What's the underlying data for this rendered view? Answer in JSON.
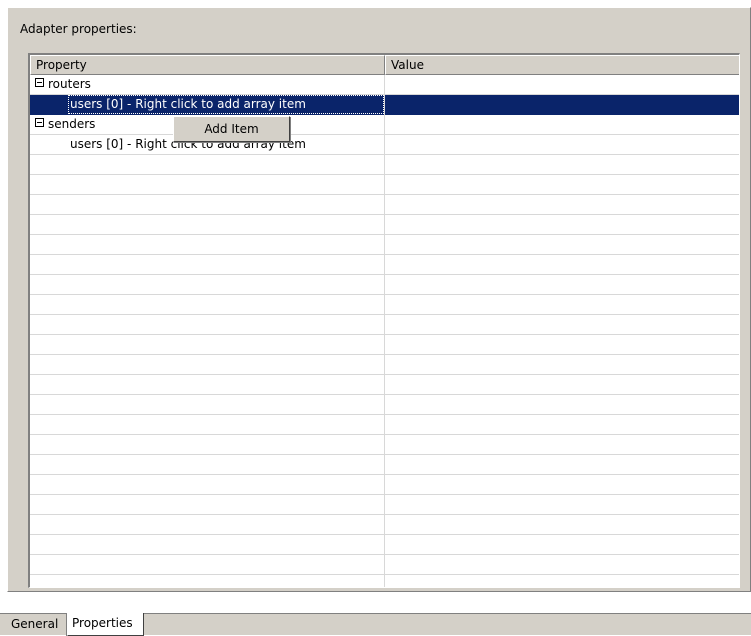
{
  "panel": {
    "label": "Adapter properties:"
  },
  "table": {
    "columns": [
      "Property",
      "Value"
    ],
    "rows": [
      {
        "label": "routers",
        "expander": true,
        "selected": false
      },
      {
        "label": "users [0]  -  Right click to add array item",
        "expander": false,
        "selected": true
      },
      {
        "label": "senders",
        "expander": true,
        "selected": false
      },
      {
        "label": "users [0]  -  Right click to add array item",
        "expander": false,
        "selected": false
      }
    ]
  },
  "context_menu": {
    "items": [
      "Add Item"
    ]
  },
  "tabs": [
    {
      "label": "General",
      "active": false
    },
    {
      "label": "Properties",
      "active": true
    }
  ],
  "colors": {
    "panel_bg": "#d4d0c8",
    "selection": "#0a246a",
    "grid_line": "#d8d8d8"
  },
  "icons": {
    "expander": "tree-collapse-minus-icon"
  }
}
